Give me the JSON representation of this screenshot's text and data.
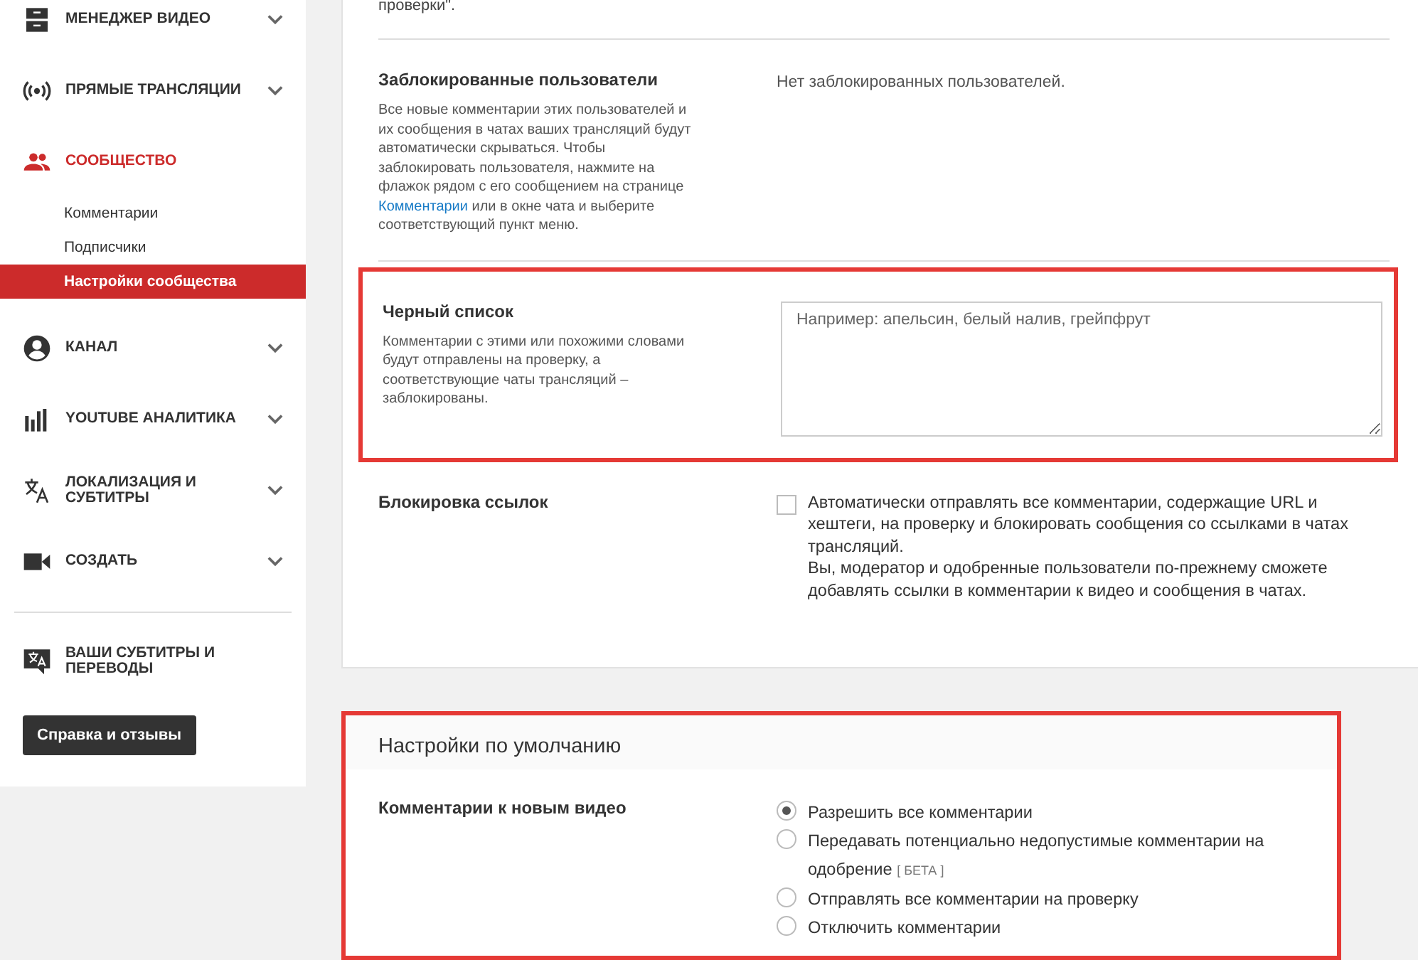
{
  "sidebar": {
    "items": [
      {
        "label": "МЕНЕДЖЕР ВИДЕО",
        "selected": false,
        "expanded": false
      },
      {
        "label": "ПРЯМЫЕ ТРАНСЛЯЦИИ",
        "selected": false,
        "expanded": false
      },
      {
        "label": "СООБЩЕСТВО",
        "selected": true,
        "expanded": true,
        "children": [
          {
            "label": "Комментарии",
            "selected": false
          },
          {
            "label": "Подписчики",
            "selected": false
          },
          {
            "label": "Настройки сообщества",
            "selected": true
          }
        ]
      },
      {
        "label": "КАНАЛ",
        "selected": false,
        "expanded": false
      },
      {
        "label": "YOUTUBE АНАЛИТИКА",
        "selected": false,
        "expanded": false
      },
      {
        "label": "ЛОКАЛИЗАЦИЯ И СУБТИТРЫ",
        "selected": false,
        "expanded": false
      },
      {
        "label": "СОЗДАТЬ",
        "selected": false,
        "expanded": false
      }
    ],
    "extra_item": "ВАШИ СУБТИТРЫ И ПЕРЕВОДЫ",
    "help_button": "Справка и отзывы"
  },
  "top_cut_text": "проверки\".",
  "blocked_users": {
    "title": "Заблокированные пользователи",
    "description": "Все новые комментарии этих пользователей и их сообщения в чатах ваших трансляций будут автоматически скрываться. Чтобы заблокировать пользователя, нажмите на флажок рядом с его сообщением на странице",
    "link": "Комментарии",
    "description_end": "или в окне чата и выберите соответствующий пункт меню.",
    "value": "Нет заблокированных пользователей."
  },
  "blacklist": {
    "title": "Черный список",
    "description": "Комментарии с этими или похожими словами будут отправлены на проверку, а соответствующие чаты трансляций – заблокированы.",
    "placeholder": "Например: апельсин, белый налив, грейпфрут",
    "highlighted": true
  },
  "link_blocking": {
    "title": "Блокировка ссылок",
    "checked": false,
    "text": "Автоматически отправлять все комментарии, содержащие URL и хештеги, на проверку и блокировать сообщения со ссылками в чатах трансляций.",
    "note": "Вы, модератор и одобренные пользователи по-прежнему сможете добавлять ссылки в комментарии к видео и сообщения в чатах."
  },
  "defaults": {
    "title": "Настройки по умолчанию",
    "highlighted": true,
    "label": "Комментарии к новым видео",
    "options": [
      {
        "label": "Разрешить все комментарии",
        "selected": true
      },
      {
        "label": "Передавать потенциально недопустимые комментарии на одобрение",
        "badge": "[ БЕТА ]",
        "selected": false
      },
      {
        "label": "Отправлять все комментарии на проверку",
        "selected": false
      },
      {
        "label": "Отключить комментарии",
        "selected": false
      }
    ]
  }
}
